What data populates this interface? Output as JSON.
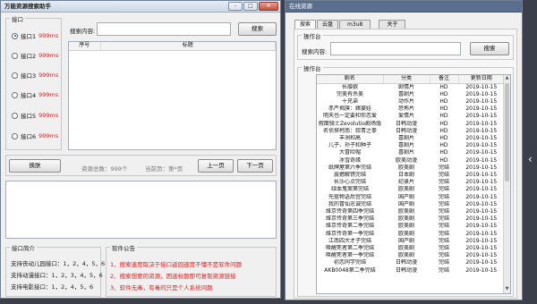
{
  "left_window": {
    "title": "万能资源搜索助手",
    "win_buttons": {
      "min": "-",
      "max": "□",
      "close": "✕"
    },
    "interface_group": {
      "label": "接口",
      "items": [
        {
          "label": "接口1",
          "ms": "999ms",
          "selected": true
        },
        {
          "label": "接口2",
          "ms": "999ms",
          "selected": false
        },
        {
          "label": "接口3",
          "ms": "999ms",
          "selected": false
        },
        {
          "label": "接口4",
          "ms": "999ms",
          "selected": false
        },
        {
          "label": "接口5",
          "ms": "999ms",
          "selected": false
        },
        {
          "label": "接口6",
          "ms": "999ms",
          "selected": false
        }
      ]
    },
    "search": {
      "label": "搜索内容:",
      "value": "",
      "button": "搜索"
    },
    "results": {
      "col_index": "序号",
      "col_title": "标题"
    },
    "switch_button": "换肤",
    "resource_total": "资源总数：999个",
    "current_page": "当前页：第*页",
    "prev_button": "上一页",
    "next_button": "下一页",
    "intro": {
      "label": "接口简介",
      "lines": [
        "支持丧动儿园接口：1，2，4，5，6",
        "支持动漫接口：1，2，3，4，5，6",
        "支持电影接口：1，2，4，5，6"
      ]
    },
    "notice": {
      "label": "软件公告",
      "lines": [
        "1、搜索速度取决于接口返回速度不懂不是软件问题",
        "2、搜索想要的资源，因选标题即可复制资源链接",
        "3、软件无毒，有毒的只是个人系统问题"
      ]
    }
  },
  "right_window": {
    "title": "在线资源",
    "tabs": [
      "搜索",
      "云盘",
      "m3u8",
      "关于"
    ],
    "op_group": {
      "label": "操作台",
      "search_label": "搜索内容:",
      "value": "",
      "button": "搜索"
    },
    "list_group": {
      "label": "操作台",
      "columns": [
        "剧名",
        "分类",
        "备注",
        "更新日期"
      ],
      "rows": [
        [
          "长缨歌",
          "剧情片",
          "HD",
          "2019-10-15"
        ],
        [
          "完美有杀美",
          "喜剧片",
          "HD",
          "2019-10-15"
        ],
        [
          "十兄弟",
          "动作片",
          "HD",
          "2019-10-15"
        ],
        [
          "赤严揭旗：嫁娶娃",
          "恐怖片",
          "HD",
          "2019-10-15"
        ],
        [
          "明天也一定要和你恋爱",
          "爱情片",
          "HD",
          "2019-10-15"
        ],
        [
          "假面骑士Zevolutio剧场版",
          "日韩动漫",
          "HD",
          "2019-10-15"
        ],
        [
          "名侦探柯南：绀青之拳",
          "日韩动漫",
          "HD",
          "2019-10-15"
        ],
        [
          "丰洲和高",
          "喜剧片",
          "HD",
          "2019-10-15"
        ],
        [
          "儿子、孙子和种子",
          "喜剧片",
          "HD",
          "2019-10-15"
        ],
        [
          "大冒险帽",
          "喜剧片",
          "HD",
          "2019-10-15"
        ],
        [
          "冰雪奇缘",
          "欧美动漫",
          "HD",
          "2019-10-15"
        ],
        [
          "纸牌屋第六季完结",
          "欧美剧",
          "完结",
          "2019-10-15"
        ],
        [
          "震撼解锈完结",
          "日本剧",
          "完结",
          "2019-10-15"
        ],
        [
          "长沙心点完结",
          "纪录片",
          "完结",
          "2019-10-15"
        ],
        [
          "绿血鬼案第完结",
          "欧美剧",
          "完结",
          "2019-10-15"
        ],
        [
          "先驱物语后宫完结",
          "国产剧",
          "完结",
          "2019-10-15"
        ],
        [
          "我的冒仙忠诚完结",
          "国产剧",
          "完结",
          "2019-10-15"
        ],
        [
          "维京传奇第四季完结",
          "欧美剧",
          "完结",
          "2019-10-15"
        ],
        [
          "维京传奇第三季完结",
          "欧美剧",
          "完结",
          "2019-10-15"
        ],
        [
          "维京传奇第二季完结",
          "欧美剧",
          "完结",
          "2019-10-15"
        ],
        [
          "维京传奇第一季完结",
          "欧美剧",
          "完结",
          "2019-10-15"
        ],
        [
          "江南四大才子完结",
          "国产剧",
          "完结",
          "2019-10-15"
        ],
        [
          "唤醒死者第二季完结",
          "欧美剧",
          "完结",
          "2019-10-15"
        ],
        [
          "唤醒死者第一季完结",
          "欧美剧",
          "完结",
          "2019-10-15"
        ],
        [
          "初恋同学完结",
          "日韩动漫",
          "完结",
          "2019-10-15"
        ],
        [
          "AKB0048第二季完结",
          "日韩动漫",
          "完结",
          "2019-10-15"
        ]
      ]
    }
  },
  "side_arrow": "‹"
}
